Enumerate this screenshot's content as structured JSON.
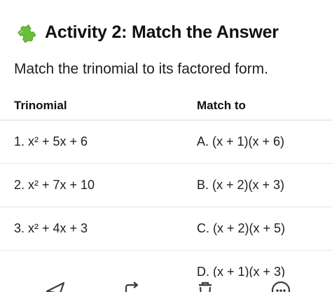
{
  "header": {
    "icon": "puzzle-piece-icon",
    "title": "Activity 2: Match the Answer"
  },
  "instruction": "Match the trinomial to its factored form.",
  "table": {
    "columns": [
      "Trinomial",
      "Match to"
    ],
    "rows": [
      {
        "trinomial": "1. x² + 5x + 6",
        "match": "A. (x + 1)(x + 6)"
      },
      {
        "trinomial": "2. x² + 7x + 10",
        "match": "B. (x + 2)(x + 3)"
      },
      {
        "trinomial": "3. x² + 4x + 3",
        "match": "C. (x + 2)(x + 5)"
      },
      {
        "trinomial": "",
        "match": "D. (x + 1)(x + 3)"
      }
    ]
  },
  "bottom_bar": {
    "icons": [
      "send-icon",
      "share-icon",
      "trash-icon",
      "more-icon"
    ]
  },
  "colors": {
    "puzzle_green": "#6abf3b",
    "text": "#1f1f1f",
    "divider": "#e6e6e6"
  }
}
